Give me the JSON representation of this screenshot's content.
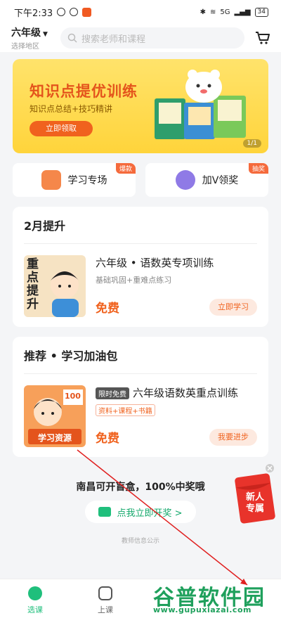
{
  "status_bar": {
    "time": "下午2:33",
    "network": "5G",
    "battery": "34"
  },
  "header": {
    "grade": "六年级",
    "region": "选择地区",
    "search_placeholder": "搜索老师和课程"
  },
  "banner": {
    "title": "知识点提优训练",
    "subtitle": "知识点总结+技巧精讲",
    "button": "立即领取",
    "pager": "1/1"
  },
  "quick_entries": [
    {
      "label": "学习专场",
      "tag": "爆款"
    },
    {
      "label": "加V领奖",
      "tag": "抽奖"
    }
  ],
  "section_feb": {
    "title": "2月提升",
    "course": {
      "title": "六年级 • 语数英专项训练",
      "subtitle": "基础巩固+重难点练习",
      "price": "免费",
      "button": "立即学习",
      "thumb_text": "重点提升"
    }
  },
  "section_rec": {
    "title": "推荐 • 学习加油包",
    "course": {
      "tag": "限时免费",
      "title": "六年级语数英重点训练",
      "chips": "资料+课程+书籍",
      "price": "免费",
      "button": "我要进步",
      "thumb_text": "学习资源",
      "thumb_num": "100"
    }
  },
  "blind_box": {
    "title": "南昌可开盲盒，100%中奖哦",
    "button": "点我立即开奖 >"
  },
  "footer_text": "教师信息公示",
  "red_packet": {
    "text": "新人专属"
  },
  "tabs": [
    {
      "label": "选课",
      "active": true
    },
    {
      "label": "上课",
      "active": false
    }
  ],
  "watermark": {
    "title": "谷普软件园",
    "url": "www.gupuxiazai.com"
  },
  "colors": {
    "accent": "#1fbf7c",
    "orange": "#f0621e",
    "banner_yellow": "#ffd43b"
  }
}
